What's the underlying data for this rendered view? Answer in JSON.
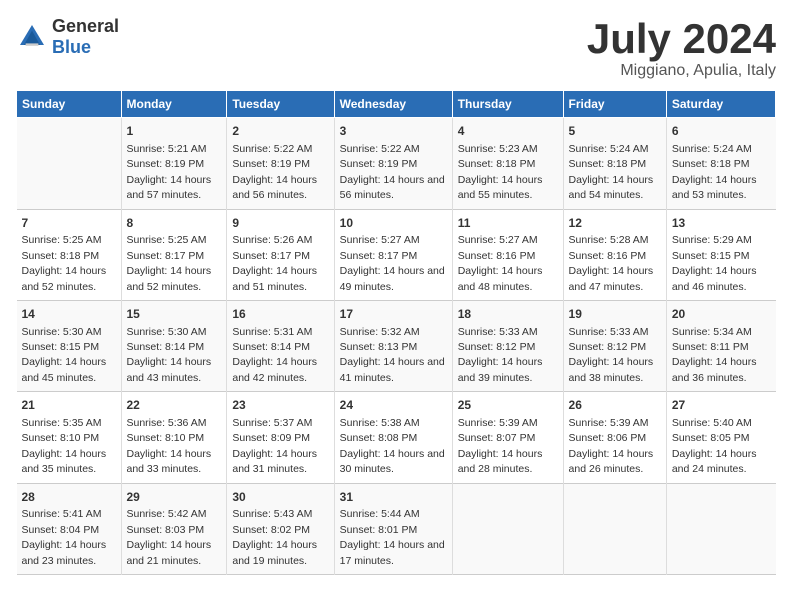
{
  "logo": {
    "general": "General",
    "blue": "Blue"
  },
  "title": "July 2024",
  "subtitle": "Miggiano, Apulia, Italy",
  "days_of_week": [
    "Sunday",
    "Monday",
    "Tuesday",
    "Wednesday",
    "Thursday",
    "Friday",
    "Saturday"
  ],
  "weeks": [
    [
      {
        "day": "",
        "sunrise": "",
        "sunset": "",
        "daylight": ""
      },
      {
        "day": "1",
        "sunrise": "Sunrise: 5:21 AM",
        "sunset": "Sunset: 8:19 PM",
        "daylight": "Daylight: 14 hours and 57 minutes."
      },
      {
        "day": "2",
        "sunrise": "Sunrise: 5:22 AM",
        "sunset": "Sunset: 8:19 PM",
        "daylight": "Daylight: 14 hours and 56 minutes."
      },
      {
        "day": "3",
        "sunrise": "Sunrise: 5:22 AM",
        "sunset": "Sunset: 8:19 PM",
        "daylight": "Daylight: 14 hours and 56 minutes."
      },
      {
        "day": "4",
        "sunrise": "Sunrise: 5:23 AM",
        "sunset": "Sunset: 8:18 PM",
        "daylight": "Daylight: 14 hours and 55 minutes."
      },
      {
        "day": "5",
        "sunrise": "Sunrise: 5:24 AM",
        "sunset": "Sunset: 8:18 PM",
        "daylight": "Daylight: 14 hours and 54 minutes."
      },
      {
        "day": "6",
        "sunrise": "Sunrise: 5:24 AM",
        "sunset": "Sunset: 8:18 PM",
        "daylight": "Daylight: 14 hours and 53 minutes."
      }
    ],
    [
      {
        "day": "7",
        "sunrise": "Sunrise: 5:25 AM",
        "sunset": "Sunset: 8:18 PM",
        "daylight": "Daylight: 14 hours and 52 minutes."
      },
      {
        "day": "8",
        "sunrise": "Sunrise: 5:25 AM",
        "sunset": "Sunset: 8:17 PM",
        "daylight": "Daylight: 14 hours and 52 minutes."
      },
      {
        "day": "9",
        "sunrise": "Sunrise: 5:26 AM",
        "sunset": "Sunset: 8:17 PM",
        "daylight": "Daylight: 14 hours and 51 minutes."
      },
      {
        "day": "10",
        "sunrise": "Sunrise: 5:27 AM",
        "sunset": "Sunset: 8:17 PM",
        "daylight": "Daylight: 14 hours and 49 minutes."
      },
      {
        "day": "11",
        "sunrise": "Sunrise: 5:27 AM",
        "sunset": "Sunset: 8:16 PM",
        "daylight": "Daylight: 14 hours and 48 minutes."
      },
      {
        "day": "12",
        "sunrise": "Sunrise: 5:28 AM",
        "sunset": "Sunset: 8:16 PM",
        "daylight": "Daylight: 14 hours and 47 minutes."
      },
      {
        "day": "13",
        "sunrise": "Sunrise: 5:29 AM",
        "sunset": "Sunset: 8:15 PM",
        "daylight": "Daylight: 14 hours and 46 minutes."
      }
    ],
    [
      {
        "day": "14",
        "sunrise": "Sunrise: 5:30 AM",
        "sunset": "Sunset: 8:15 PM",
        "daylight": "Daylight: 14 hours and 45 minutes."
      },
      {
        "day": "15",
        "sunrise": "Sunrise: 5:30 AM",
        "sunset": "Sunset: 8:14 PM",
        "daylight": "Daylight: 14 hours and 43 minutes."
      },
      {
        "day": "16",
        "sunrise": "Sunrise: 5:31 AM",
        "sunset": "Sunset: 8:14 PM",
        "daylight": "Daylight: 14 hours and 42 minutes."
      },
      {
        "day": "17",
        "sunrise": "Sunrise: 5:32 AM",
        "sunset": "Sunset: 8:13 PM",
        "daylight": "Daylight: 14 hours and 41 minutes."
      },
      {
        "day": "18",
        "sunrise": "Sunrise: 5:33 AM",
        "sunset": "Sunset: 8:12 PM",
        "daylight": "Daylight: 14 hours and 39 minutes."
      },
      {
        "day": "19",
        "sunrise": "Sunrise: 5:33 AM",
        "sunset": "Sunset: 8:12 PM",
        "daylight": "Daylight: 14 hours and 38 minutes."
      },
      {
        "day": "20",
        "sunrise": "Sunrise: 5:34 AM",
        "sunset": "Sunset: 8:11 PM",
        "daylight": "Daylight: 14 hours and 36 minutes."
      }
    ],
    [
      {
        "day": "21",
        "sunrise": "Sunrise: 5:35 AM",
        "sunset": "Sunset: 8:10 PM",
        "daylight": "Daylight: 14 hours and 35 minutes."
      },
      {
        "day": "22",
        "sunrise": "Sunrise: 5:36 AM",
        "sunset": "Sunset: 8:10 PM",
        "daylight": "Daylight: 14 hours and 33 minutes."
      },
      {
        "day": "23",
        "sunrise": "Sunrise: 5:37 AM",
        "sunset": "Sunset: 8:09 PM",
        "daylight": "Daylight: 14 hours and 31 minutes."
      },
      {
        "day": "24",
        "sunrise": "Sunrise: 5:38 AM",
        "sunset": "Sunset: 8:08 PM",
        "daylight": "Daylight: 14 hours and 30 minutes."
      },
      {
        "day": "25",
        "sunrise": "Sunrise: 5:39 AM",
        "sunset": "Sunset: 8:07 PM",
        "daylight": "Daylight: 14 hours and 28 minutes."
      },
      {
        "day": "26",
        "sunrise": "Sunrise: 5:39 AM",
        "sunset": "Sunset: 8:06 PM",
        "daylight": "Daylight: 14 hours and 26 minutes."
      },
      {
        "day": "27",
        "sunrise": "Sunrise: 5:40 AM",
        "sunset": "Sunset: 8:05 PM",
        "daylight": "Daylight: 14 hours and 24 minutes."
      }
    ],
    [
      {
        "day": "28",
        "sunrise": "Sunrise: 5:41 AM",
        "sunset": "Sunset: 8:04 PM",
        "daylight": "Daylight: 14 hours and 23 minutes."
      },
      {
        "day": "29",
        "sunrise": "Sunrise: 5:42 AM",
        "sunset": "Sunset: 8:03 PM",
        "daylight": "Daylight: 14 hours and 21 minutes."
      },
      {
        "day": "30",
        "sunrise": "Sunrise: 5:43 AM",
        "sunset": "Sunset: 8:02 PM",
        "daylight": "Daylight: 14 hours and 19 minutes."
      },
      {
        "day": "31",
        "sunrise": "Sunrise: 5:44 AM",
        "sunset": "Sunset: 8:01 PM",
        "daylight": "Daylight: 14 hours and 17 minutes."
      },
      {
        "day": "",
        "sunrise": "",
        "sunset": "",
        "daylight": ""
      },
      {
        "day": "",
        "sunrise": "",
        "sunset": "",
        "daylight": ""
      },
      {
        "day": "",
        "sunrise": "",
        "sunset": "",
        "daylight": ""
      }
    ]
  ]
}
